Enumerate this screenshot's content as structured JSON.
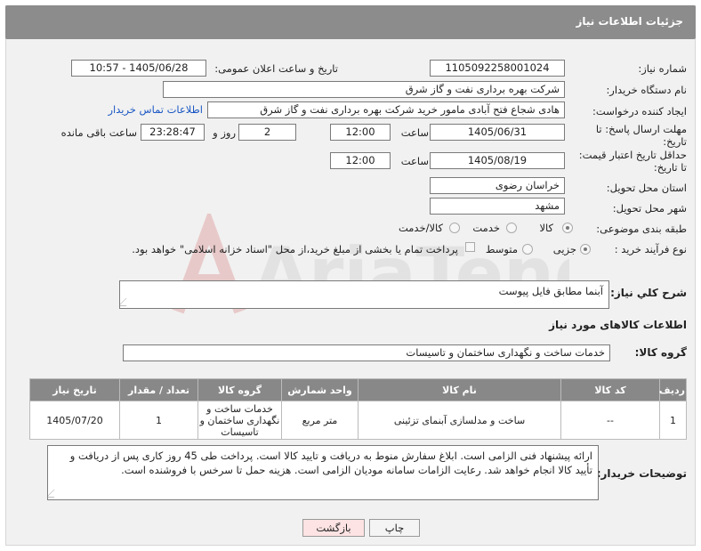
{
  "header": {
    "title": "جزئیات اطلاعات نیاز"
  },
  "fields": {
    "need_number_label": "شماره نیاز:",
    "need_number": "1105092258001024",
    "announce_label": "تاریخ و ساعت اعلان عمومی:",
    "announce_value": "1405/06/28 - 10:57",
    "buyer_org_label": "نام دستگاه خریدار:",
    "buyer_org": "شرکت بهره برداری نفت و گاز شرق",
    "requester_label": "ایجاد کننده درخواست:",
    "requester": "هادی شجاع فتح آبادی مامور خرید شرکت بهره برداری نفت و گاز شرق",
    "contact_link": "اطلاعات تماس خریدار",
    "deadline_label_1": "مهلت ارسال پاسخ: تا",
    "deadline_label_2": "تاریخ:",
    "deadline_date": "1405/06/31",
    "time_label": "ساعت",
    "deadline_time": "12:00",
    "days_value": "2",
    "days_label": "روز و",
    "remaining_time": "23:28:47",
    "remaining_label": "ساعت باقی مانده",
    "price_label_1": "حداقل تاریخ اعتبار قیمت:",
    "price_label_2": "تا تاریخ:",
    "price_date": "1405/08/19",
    "price_time": "12:00",
    "province_label": "استان محل تحویل:",
    "province": "خراسان رضوی",
    "city_label": "شهر محل تحویل:",
    "city": "مشهد",
    "category_label": "طبقه بندی موضوعی:",
    "category_options": [
      "کالا",
      "خدمت",
      "کالا/خدمت"
    ],
    "process_label": "نوع فرآیند خرید :",
    "process_options": [
      "جزیی",
      "متوسط"
    ],
    "payment_note": "پرداخت تمام یا بخشی از مبلغ خرید،از محل \"اسناد خزانه اسلامی\" خواهد بود."
  },
  "description": {
    "label": "شرح کلي نياز:",
    "value": "آبنما مطابق فایل پیوست"
  },
  "goods_section": {
    "title": "اطلاعات کالاهای مورد نیاز"
  },
  "goods_group": {
    "label": "گروه کالا:",
    "value": "خدمات ساخت و نگهداری ساختمان و تاسیسات"
  },
  "table": {
    "headers": [
      "ردیف",
      "کد کالا",
      "نام کالا",
      "واحد شمارش",
      "گروه کالا",
      "تعداد / مقدار",
      "تاریخ نیاز"
    ],
    "rows": [
      [
        "1",
        "--",
        "ساخت و مدلسازی آبنمای تزئینی",
        "متر مربع",
        "خدمات ساخت و نگهداری ساختمان و تاسیسات",
        "1",
        "1405/07/20"
      ]
    ]
  },
  "buyer_notes": {
    "label": "توضیحات خریدار:",
    "value": "ارائه پیشنهاد فنی الزامی است. ابلاغ سفارش منوط به دریافت و تایید کالا است. پرداخت طی  45 روز کاری پس از دریافت و تأیید کالا انجام خواهد شد. رعایت الزامات سامانه مودیان الزامی است. هزینه حمل تا سرخس  با فروشنده است."
  },
  "buttons": {
    "print": "چاپ",
    "back": "بازگشت"
  },
  "colors": {
    "header_bg": "#8c8c8c",
    "link": "#1a57c4",
    "back_bg": "#fde3e3"
  }
}
